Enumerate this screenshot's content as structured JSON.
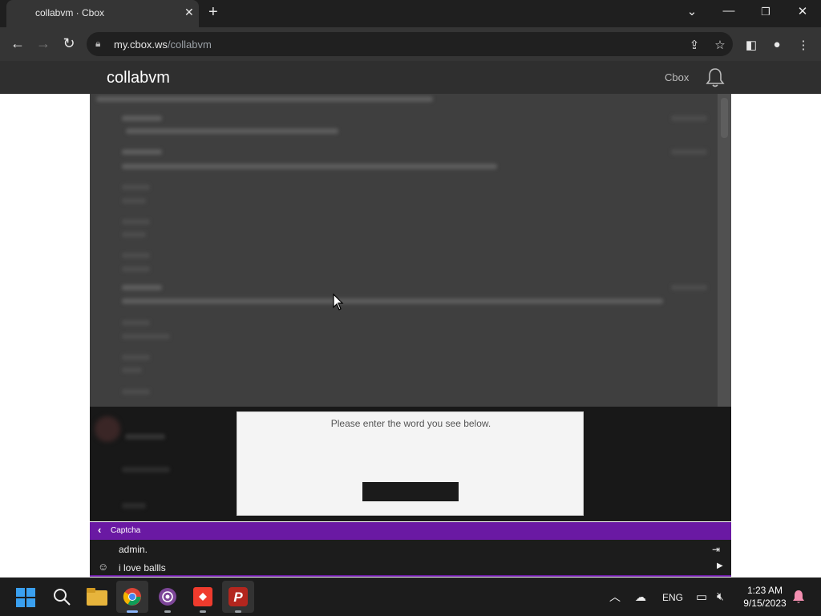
{
  "browser": {
    "tab_title": "collabvm · Cbox",
    "url_host": "my.cbox.ws",
    "url_path": "/collabvm"
  },
  "site": {
    "title": "collabvm",
    "brand": "Cbox"
  },
  "captcha": {
    "prompt": "Please enter the word you see below.",
    "bar_label": "Captcha"
  },
  "compose": {
    "name_value": "admin.",
    "message_value": "i love ballls"
  },
  "taskbar": {
    "language": "ENG",
    "time": "1:23 AM",
    "date": "9/15/2023"
  },
  "colors": {
    "accent_purple": "#6a19a3",
    "chat_bg": "#3f3f3f",
    "header_bg": "#2f2f2f"
  }
}
